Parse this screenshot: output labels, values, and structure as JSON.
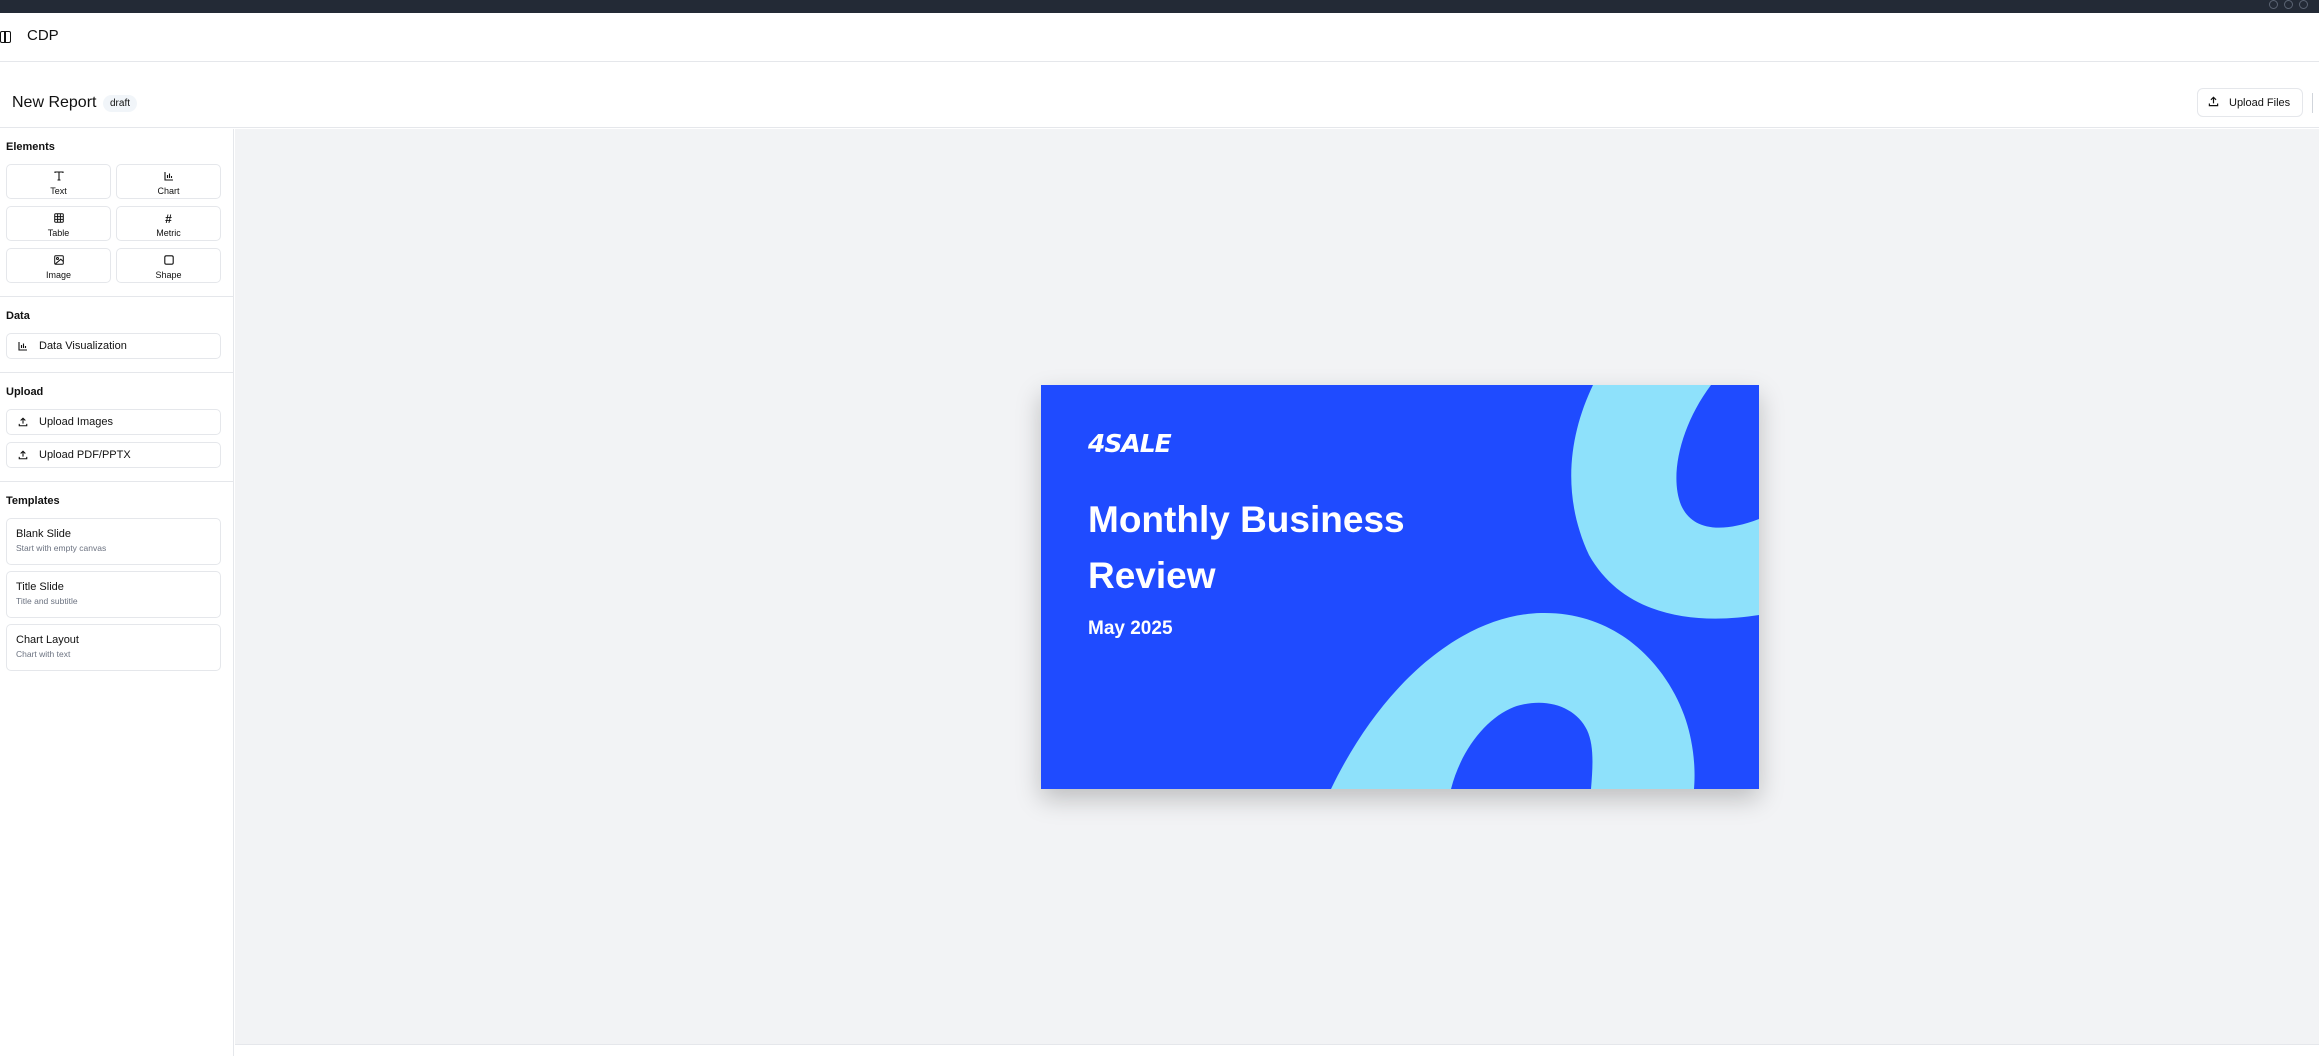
{
  "app": {
    "title": "CDP"
  },
  "report": {
    "title": "New Report",
    "status": "draft",
    "upload_files_label": "Upload Files"
  },
  "sidebar": {
    "elements": {
      "title": "Elements",
      "items": [
        {
          "label": "Text",
          "icon": "text-icon",
          "glyph": "T"
        },
        {
          "label": "Chart",
          "icon": "chart-icon",
          "glyph": ""
        },
        {
          "label": "Table",
          "icon": "table-icon",
          "glyph": ""
        },
        {
          "label": "Metric",
          "icon": "hash-icon",
          "glyph": "#"
        },
        {
          "label": "Image",
          "icon": "image-icon",
          "glyph": ""
        },
        {
          "label": "Shape",
          "icon": "square-icon",
          "glyph": ""
        }
      ]
    },
    "data": {
      "title": "Data",
      "items": [
        {
          "label": "Data Visualization",
          "icon": "chart-icon"
        }
      ]
    },
    "upload": {
      "title": "Upload",
      "items": [
        {
          "label": "Upload Images",
          "icon": "upload-icon"
        },
        {
          "label": "Upload PDF/PPTX",
          "icon": "upload-icon"
        }
      ]
    },
    "templates": {
      "title": "Templates",
      "items": [
        {
          "title": "Blank Slide",
          "subtitle": "Start with empty canvas"
        },
        {
          "title": "Title Slide",
          "subtitle": "Title and subtitle"
        },
        {
          "title": "Chart Layout",
          "subtitle": "Chart with text"
        }
      ]
    }
  },
  "slide": {
    "logo_text": "4SALE",
    "headline": "Monthly Business Review",
    "date": "May 2025",
    "colors": {
      "background": "#1f4bff",
      "accent": "#8ee1fb",
      "text": "#ffffff"
    }
  }
}
